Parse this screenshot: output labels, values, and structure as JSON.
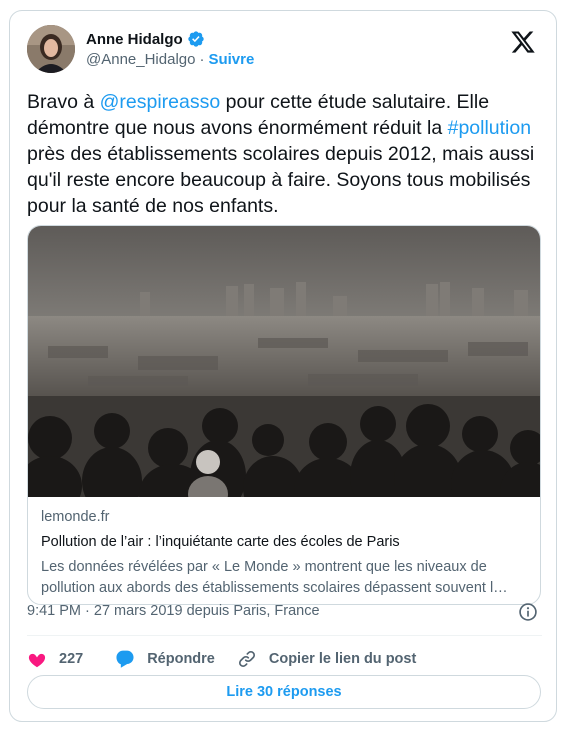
{
  "author": {
    "name": "Anne Hidalgo",
    "handle": "@Anne_Hidalgo",
    "separator": "·",
    "follow_label": "Suivre"
  },
  "tweet": {
    "text_pre": "Bravo à ",
    "mention": "@respireasso",
    "text_mid": " pour cette étude salutaire. Elle démontre que nous avons énormément réduit la ",
    "hashtag": "#pollution",
    "text_post": " près des établissements scolaires depuis 2012, mais aussi qu'il reste encore beaucoup à faire. Soyons tous mobilisés pour la santé de nos enfants."
  },
  "card": {
    "domain": "lemonde.fr",
    "title": "Pollution de l’air : l’inquiétante carte des écoles de Paris",
    "description_line1": "Les données révélées par « Le Monde » montrent que les niveaux de",
    "description_line2": "pollution aux abords des établissements scolaires dépassent souvent l…"
  },
  "timestamp": "9:41 PM · 27 mars 2019 depuis Paris, France",
  "actions": {
    "likes_count": "227",
    "reply_label": "Répondre",
    "copy_link_label": "Copier le lien du post"
  },
  "read_replies_label": "Lire 30 réponses",
  "colors": {
    "accent": "#1d9bf0",
    "like": "#f91880",
    "text": "#0f1419",
    "secondary": "#536471",
    "border": "#cfd9de"
  },
  "icons": [
    "verified-badge-icon",
    "x-logo-icon",
    "info-icon",
    "heart-icon",
    "reply-bubble-icon",
    "link-icon"
  ]
}
